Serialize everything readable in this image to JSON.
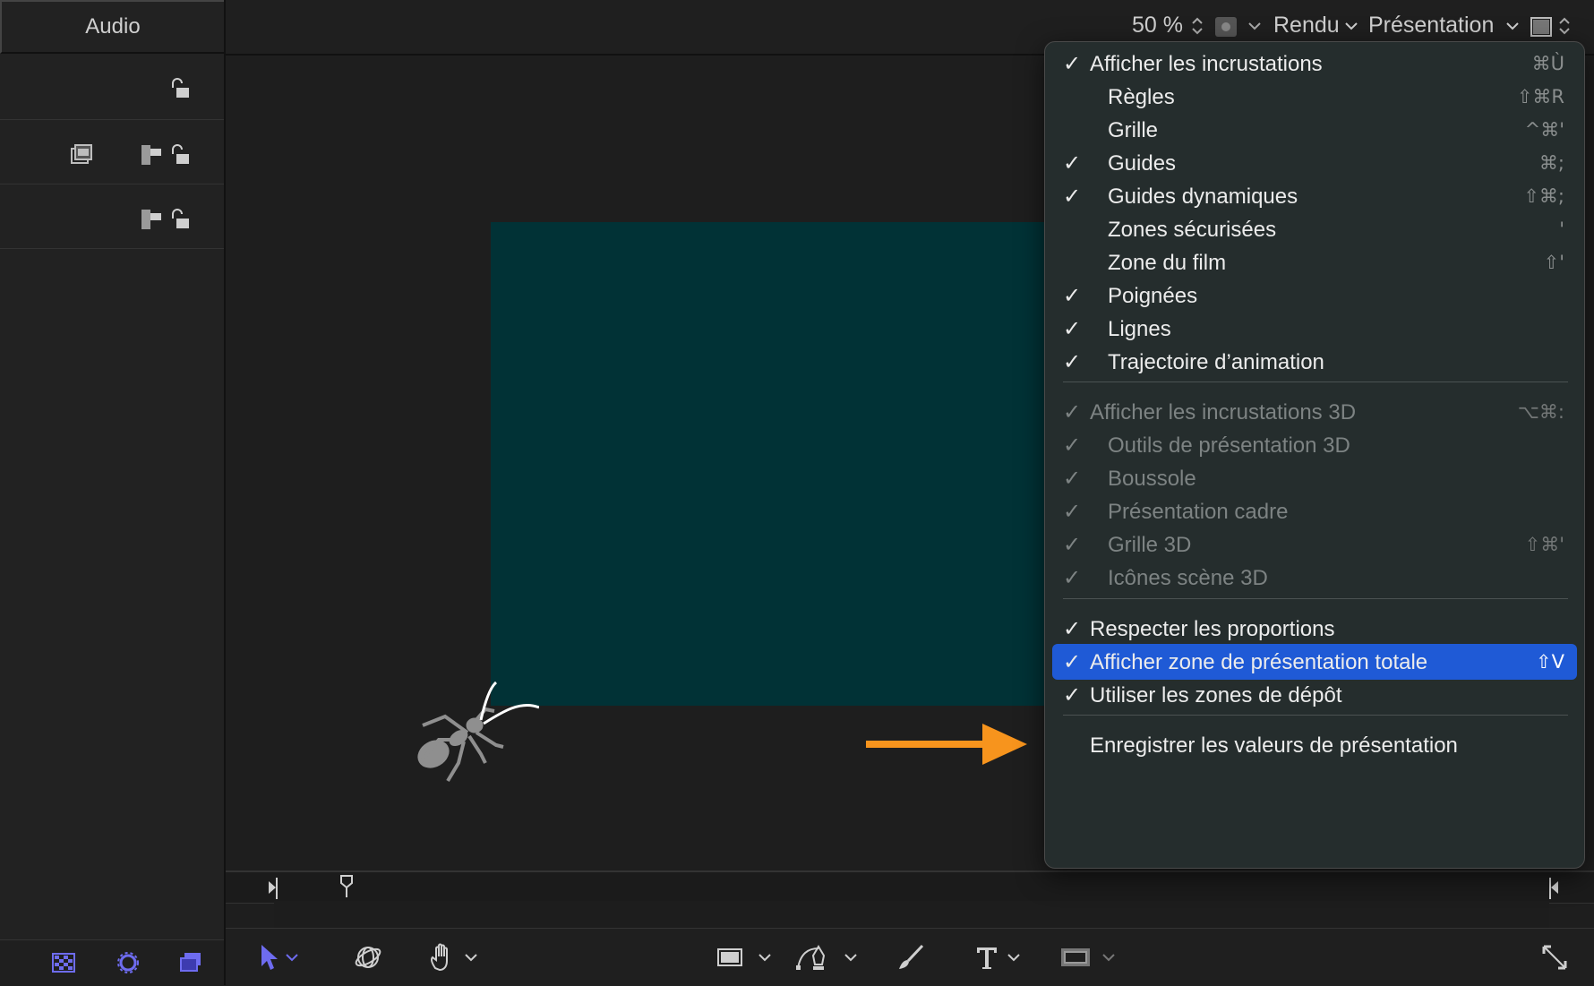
{
  "left_panel": {
    "tab_label": "Audio"
  },
  "topbar": {
    "zoom": "50 %",
    "render_label": "Rendu",
    "presentation_label": "Présentation"
  },
  "menu": {
    "items": [
      {
        "label": "Afficher les incrustations",
        "checked": true,
        "shortcut": "⌘Ù",
        "disabled": false
      },
      {
        "label": "Règles",
        "checked": false,
        "shortcut": "⇧⌘R",
        "disabled": false
      },
      {
        "label": "Grille",
        "checked": false,
        "shortcut": "^⌘'",
        "disabled": false
      },
      {
        "label": "Guides",
        "checked": true,
        "shortcut": "⌘;",
        "disabled": false
      },
      {
        "label": "Guides dynamiques",
        "checked": true,
        "shortcut": "⇧⌘;",
        "disabled": false
      },
      {
        "label": "Zones sécurisées",
        "checked": false,
        "shortcut": "'",
        "disabled": false
      },
      {
        "label": "Zone du film",
        "checked": false,
        "shortcut": "⇧'",
        "disabled": false
      },
      {
        "label": "Poignées",
        "checked": true,
        "shortcut": "",
        "disabled": false
      },
      {
        "label": "Lignes",
        "checked": true,
        "shortcut": "",
        "disabled": false
      },
      {
        "label": "Trajectoire d’animation",
        "checked": true,
        "shortcut": "",
        "disabled": false
      },
      {
        "label": "Afficher les incrustations 3D",
        "checked": true,
        "shortcut": "⌥⌘:",
        "disabled": true
      },
      {
        "label": "Outils de présentation 3D",
        "checked": true,
        "shortcut": "",
        "disabled": true
      },
      {
        "label": "Boussole",
        "checked": true,
        "shortcut": "",
        "disabled": true
      },
      {
        "label": "Présentation cadre",
        "checked": true,
        "shortcut": "",
        "disabled": true
      },
      {
        "label": "Grille 3D",
        "checked": true,
        "shortcut": "⇧⌘'",
        "disabled": true
      },
      {
        "label": "Icônes scène 3D",
        "checked": true,
        "shortcut": "",
        "disabled": true
      },
      {
        "label": "Respecter les proportions",
        "checked": true,
        "shortcut": "",
        "disabled": false
      },
      {
        "label": "Afficher zone de présentation totale",
        "checked": true,
        "shortcut": "⇧V",
        "disabled": false,
        "selected": true
      },
      {
        "label": "Utiliser les zones de dépôt",
        "checked": true,
        "shortcut": "",
        "disabled": false
      },
      {
        "label": "Enregistrer les valeurs de présentation",
        "checked": false,
        "shortcut": "",
        "disabled": false
      }
    ]
  },
  "checkmark": "✓",
  "colors": {
    "accent_selection": "#1f5ad6",
    "callout_arrow": "#f7941d",
    "canvas_frame": "#013236",
    "toolbar_active": "#6e6cf0"
  }
}
